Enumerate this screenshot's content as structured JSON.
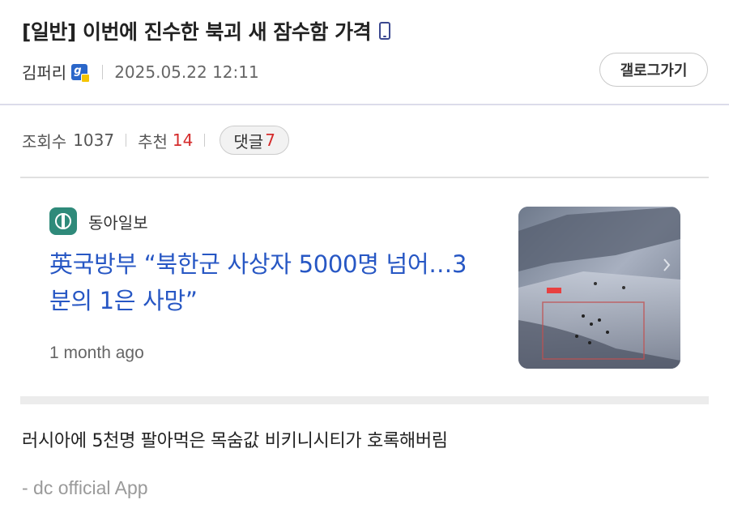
{
  "post": {
    "title": "[일반] 이번에 진수한 북괴 새 잠수함 가격",
    "author": "김퍼리",
    "date": "2025.05.22 12:11",
    "gallery_button": "갤로그가기",
    "views_label": "조회수",
    "views": "1037",
    "recommend_label": "추천",
    "recommend": "14",
    "comments_label": "댓글",
    "comments": "7"
  },
  "link_card": {
    "source": "동아일보",
    "headline": "英국방부 “북한군 사상자 5000명 넘어…3분의 1은 사망”",
    "age": "1 month ago"
  },
  "content": {
    "text": "러시아에 5천명 팔아먹은 목숨값 비키니시티가 호록해버림",
    "signature": "- dc official App"
  },
  "icons": {
    "device": "mobile-phone-icon",
    "nick_badge": "fixed-nick-badge-icon",
    "source_logo": "donga-logo-icon"
  },
  "colors": {
    "accent_red": "#d52b2b",
    "headline_blue": "#2757c4",
    "phone_icon": "#3b4890"
  }
}
